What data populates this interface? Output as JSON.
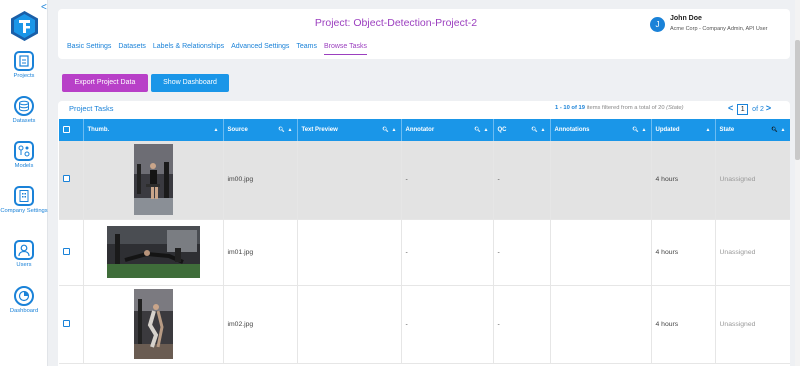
{
  "sidebar": {
    "collapse": "<",
    "items": [
      {
        "label": "Projects",
        "icon": "document-icon"
      },
      {
        "label": "Datasets",
        "icon": "database-icon"
      },
      {
        "label": "Models",
        "icon": "model-icon"
      },
      {
        "label": "Company Settings",
        "icon": "building-icon"
      },
      {
        "label": "Users",
        "icon": "user-icon"
      },
      {
        "label": "Dashboard",
        "icon": "pie-chart-icon"
      }
    ]
  },
  "header": {
    "title": "Project: Object-Detection-Project-2",
    "user": {
      "initial": "J",
      "name": "John Doe",
      "role": "Acme Corp - Company Admin, API User"
    }
  },
  "tabs": [
    {
      "label": "Basic Settings",
      "active": false
    },
    {
      "label": "Datasets",
      "active": false
    },
    {
      "label": "Labels & Relationships",
      "active": false
    },
    {
      "label": "Advanced Settings",
      "active": false
    },
    {
      "label": "Teams",
      "active": false
    },
    {
      "label": "Browse Tasks",
      "active": true
    }
  ],
  "actions": {
    "export_label": "Export Project Data",
    "dashboard_label": "Show Dashboard"
  },
  "panel": {
    "title": "Project Tasks",
    "filter_range": "1 - 10 of 19",
    "filter_mid": " items filtered from a total of 20 ",
    "filter_state": "(State)",
    "page_current": "1",
    "page_total": "of 2",
    "prev": "<",
    "next": ">"
  },
  "table": {
    "columns": [
      "Thumb.",
      "Source",
      "Text Preview",
      "Annotator",
      "QC",
      "Annotations",
      "Updated",
      "State"
    ],
    "rows": [
      {
        "source": "im00.jpg",
        "text_preview": "",
        "annotator": "-",
        "qc": "-",
        "annotations": "",
        "updated": "4 hours",
        "state": "Unassigned"
      },
      {
        "source": "im01.jpg",
        "text_preview": "",
        "annotator": "-",
        "qc": "-",
        "annotations": "",
        "updated": "4 hours",
        "state": "Unassigned"
      },
      {
        "source": "im02.jpg",
        "text_preview": "",
        "annotator": "-",
        "qc": "-",
        "annotations": "",
        "updated": "4 hours",
        "state": "Unassigned"
      }
    ]
  },
  "colors": {
    "accent": "#1a96e8",
    "brand_purple": "#9b3fbf",
    "export_button": "#b840c8"
  }
}
